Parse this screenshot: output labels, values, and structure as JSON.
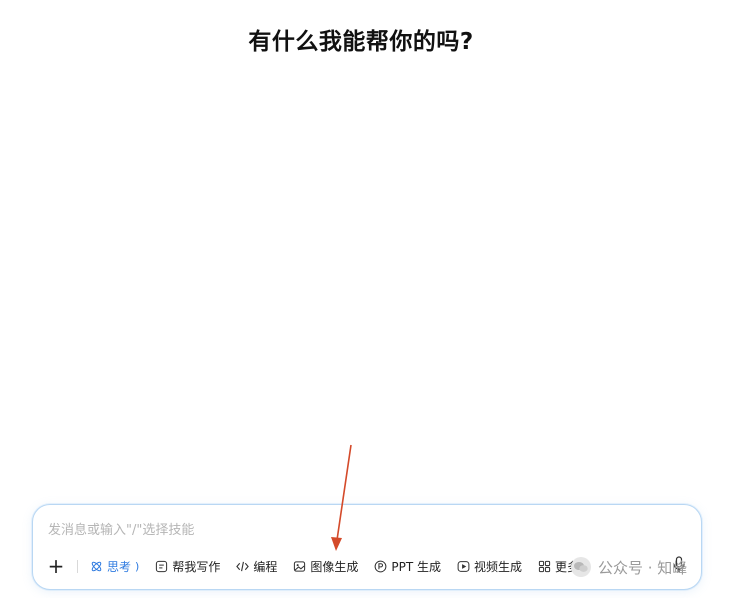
{
  "heading": "有什么我能帮你的吗?",
  "composer": {
    "placeholder": "发消息或输入\"/\"选择技能"
  },
  "toolbar": {
    "plus": "+",
    "think": "思考",
    "think_paren": ")",
    "items": [
      {
        "label": "帮我写作",
        "icon": "writing-icon"
      },
      {
        "label": "编程",
        "icon": "code-icon"
      },
      {
        "label": "图像生成",
        "icon": "image-icon"
      },
      {
        "label": "PPT 生成",
        "icon": "ppt-icon"
      },
      {
        "label": "视频生成",
        "icon": "video-icon"
      },
      {
        "label": "更多",
        "icon": "grid-icon"
      }
    ]
  },
  "watermark": {
    "text": "公众号 · 知峰"
  },
  "colors": {
    "accent": "#2f7be0",
    "arrow": "#d44a2a",
    "composer_border": "#b9d7f3"
  }
}
